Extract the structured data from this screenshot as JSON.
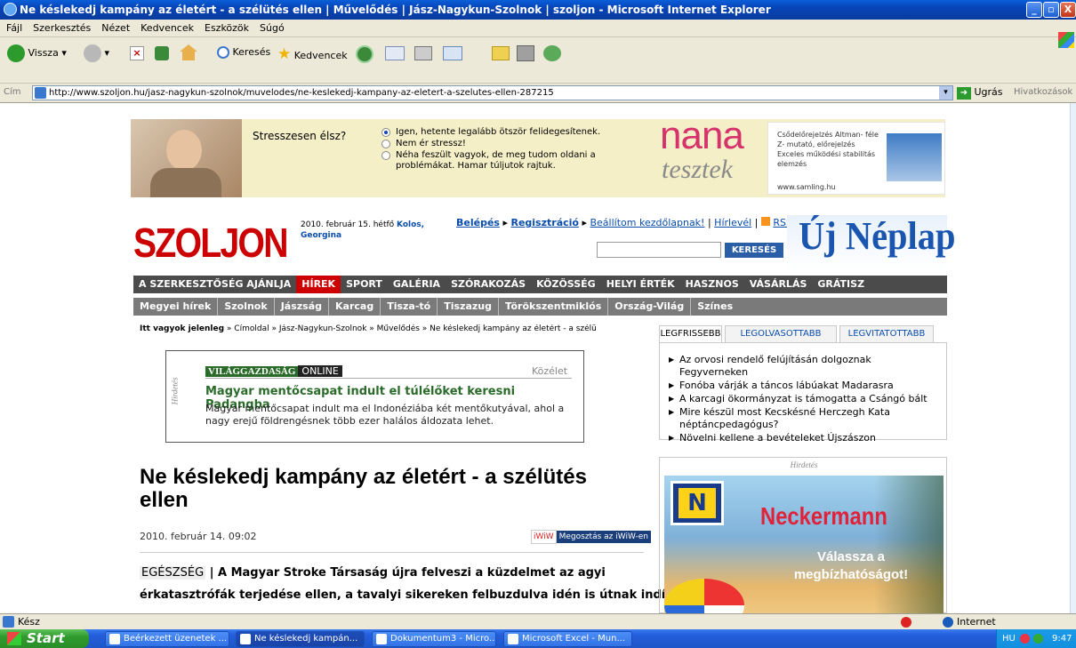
{
  "window": {
    "title": "Ne késlekedj kampány az életért - a szélütés ellen | Művelődés | Jász-Nagykun-Szolnok | szoljon - Microsoft Internet Explorer",
    "minimize": "_",
    "maximize": "▫",
    "close": "X"
  },
  "menu": [
    "Fájl",
    "Szerkesztés",
    "Nézet",
    "Kedvencek",
    "Eszközök",
    "Súgó"
  ],
  "toolbar": {
    "back": "Vissza",
    "search": "Keresés",
    "favorites": "Kedvencek"
  },
  "address": {
    "label": "Cím",
    "url": "http://www.szoljon.hu/jasz-nagykun-szolnok/muvelodes/ne-keslekedj-kampany-az-eletert-a-szelutes-ellen-287215",
    "go": "Ugrás",
    "links": "Hivatkozások"
  },
  "ad_banner": {
    "question": "Stresszesen élsz?",
    "options": [
      "Igen, hetente legalább ötször felidegesítenek.",
      "Nem ér stressz!",
      "Néha feszült vagyok, de meg tudom oldani a problémákat. Hamar túljutok rajtuk."
    ],
    "brand_top": "nana",
    "brand_bottom": "tesztek",
    "side_ad": "Csődelőrejelzés Altman- féle Z- mutató, előrejelzés Exceles működési stabilitás elemzés",
    "side_ad_url": "www.samling.hu"
  },
  "header": {
    "logo": "SZOLJON",
    "date": "2010. február 15. hétfő",
    "nameday": "Kolos, Georgina",
    "links": [
      "Belépés",
      "Regisztráció",
      "Beállítom kezdőlapnak!",
      "Hírlevél",
      "RSS"
    ],
    "search_button": "KERESÉS",
    "brand": "Új Néplap"
  },
  "nav_main": [
    "A SZERKESZTŐSÉG AJÁNLJA",
    "HÍREK",
    "SPORT",
    "GALÉRIA",
    "SZÓRAKOZÁS",
    "KÖZÖSSÉG",
    "HELYI ÉRTÉK",
    "HASZNOS",
    "VÁSÁRLÁS",
    "GRÁTISZ"
  ],
  "nav_sub": [
    "Megyei hírek",
    "Szolnok",
    "Jászság",
    "Karcag",
    "Tisza-tó",
    "Tiszazug",
    "Törökszentmiklós",
    "Ország-Világ",
    "Színes"
  ],
  "breadcrumb": {
    "label": "Itt vagyok jelenleg",
    "items": [
      "Címoldal",
      "Jász-Nagykun-Szolnok",
      "Művelődés",
      "Ne késlekedj kampány az életért - a szélü"
    ]
  },
  "inline_ad": {
    "side_label": "Hirdetés",
    "source_a": "VILÁGGAZDASÁG",
    "source_b": "ONLINE",
    "section": "Közélet",
    "headline": "Magyar mentőcsapat indult el túlélőket keresni Padangba",
    "text": "Magyar mentőcsapat indult ma el Indonéziába két mentőkutyával, ahol a nagy erejű földrengésnek több ezer halálos áldozata lehet."
  },
  "article": {
    "title": "Ne késlekedj kampány az életért - a szélütés ellen",
    "date": "2010. február 14. 09:02",
    "share": "Megosztás az iWiW-en",
    "share_brand": "iWiW",
    "category": "EGÉSZSÉG",
    "lead_line1": "A Magyar Stroke Társaság újra felveszi a küzdelmet az agyi",
    "lead_line2": "érkatasztrófák terjedése ellen, a tavalyi sikereken felbuzdulva idén is útnak indítja"
  },
  "tabs": [
    "LEGFRISSEBB",
    "LEGOLVASOTTABB",
    "LEGVITATOTTABB"
  ],
  "latest": [
    "Az orvosi rendelő felújításán dolgoznak Fegyverneken",
    "Fonóba várják a táncos lábúakat Madarasra",
    "A karcagi ökormányzat is támogatta a Csángó bált",
    "Mire készül most Kecskésné Herczegh Kata néptáncpedagógus?",
    "Növelni kellene a bevételeket Újszászon"
  ],
  "side_ad": {
    "label": "Hirdetés",
    "brand": "Neckermann",
    "logo_letter": "N",
    "slogan": "Válassza a megbízhatóságot!"
  },
  "status": {
    "text": "Kész",
    "zone": "Internet"
  },
  "taskbar": {
    "start": "Start",
    "tasks": [
      "Beérkezett üzenetek ...",
      "Ne késlekedj kampán...",
      "Dokumentum3 - Micro...",
      "Microsoft Excel - Mun..."
    ],
    "lang": "HU",
    "time": "9:47"
  },
  "colors": {
    "accent_red": "#cc0000",
    "link_blue": "#0a4dab",
    "xp_blue": "#0a5fd8"
  }
}
